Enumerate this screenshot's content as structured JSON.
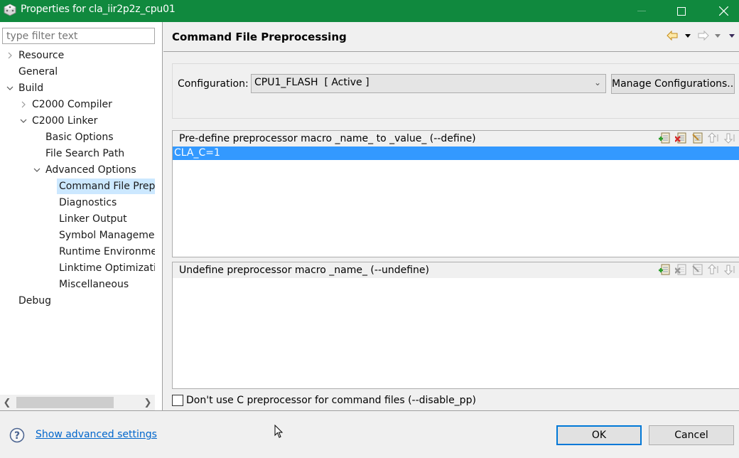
{
  "window": {
    "title": "Properties for cla_iir2p2z_cpu01",
    "titlebar_color": "#10893e",
    "controls": [
      "minimize-icon",
      "maximize-icon",
      "close-icon"
    ]
  },
  "sidebar": {
    "filter_placeholder": "type filter text",
    "items": [
      {
        "label": "Resource",
        "level": 0,
        "expander": "collapsed"
      },
      {
        "label": "General",
        "level": 0,
        "expander": "none"
      },
      {
        "label": "Build",
        "level": 0,
        "expander": "expanded"
      },
      {
        "label": "C2000 Compiler",
        "level": 1,
        "expander": "collapsed"
      },
      {
        "label": "C2000 Linker",
        "level": 1,
        "expander": "expanded"
      },
      {
        "label": "Basic Options",
        "level": 2,
        "expander": "none"
      },
      {
        "label": "File Search Path",
        "level": 2,
        "expander": "none"
      },
      {
        "label": "Advanced Options",
        "level": 2,
        "expander": "expanded"
      },
      {
        "label": "Command File Preprocessing",
        "level": 3,
        "expander": "none",
        "selected": true
      },
      {
        "label": "Diagnostics",
        "level": 3,
        "expander": "none"
      },
      {
        "label": "Linker Output",
        "level": 3,
        "expander": "none"
      },
      {
        "label": "Symbol Management",
        "level": 3,
        "expander": "none"
      },
      {
        "label": "Runtime Environment",
        "level": 3,
        "expander": "none"
      },
      {
        "label": "Linktime Optimization",
        "level": 3,
        "expander": "none"
      },
      {
        "label": "Miscellaneous",
        "level": 3,
        "expander": "none"
      },
      {
        "label": "Debug",
        "level": 0,
        "expander": "none"
      }
    ],
    "selection_color": "#cce8ff"
  },
  "main": {
    "title": "Command File Preprocessing",
    "nav": [
      "back-icon",
      "back-menu-icon",
      "forward-icon",
      "forward-menu-icon",
      "view-menu-icon"
    ],
    "configuration": {
      "label": "Configuration:",
      "value": "CPU1_FLASH  [ Active ]",
      "manage_label": "Manage Configurations..."
    },
    "define_panel": {
      "header": "Pre-define preprocessor macro _name_ to _value_ (--define)",
      "items": [
        "CLA_C=1"
      ],
      "selected_index": 0,
      "selection_color": "#3399ff",
      "tools": [
        "add-icon",
        "delete-icon",
        "edit-icon",
        "move-up-icon",
        "move-down-icon"
      ]
    },
    "undefine_panel": {
      "header": "Undefine preprocessor macro _name_ (--undefine)",
      "items": [],
      "tools": [
        "add-icon",
        "delete-icon",
        "edit-icon",
        "move-up-icon",
        "move-down-icon"
      ]
    },
    "disable_pp": {
      "label": "Don't use C preprocessor for command files (--disable_pp)",
      "checked": false
    }
  },
  "footer": {
    "help_link": "Show advanced settings",
    "ok_label": "OK",
    "cancel_label": "Cancel",
    "link_color": "#0066cc",
    "focus_color": "#0078d7"
  }
}
